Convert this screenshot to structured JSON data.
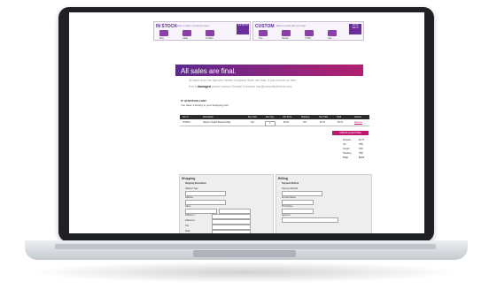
{
  "in_stock": {
    "title": "IN STOCK",
    "subtitle": "Ready to ship in 3 business days",
    "badge": "3-5 DAYS",
    "products": [
      {
        "label": "Mug"
      },
      {
        "label": "Glass"
      },
      {
        "label": "Tumbler"
      }
    ]
  },
  "custom": {
    "title": "CUSTOM",
    "subtitle": "Made to order with your logo",
    "badge": "10-15 DAYS",
    "products": [
      {
        "label": "Tote"
      },
      {
        "label": "Hoodie"
      },
      {
        "label": "T-Shirt"
      },
      {
        "label": "Cap"
      }
    ]
  },
  "sales_banner": {
    "headline": "All sales are final."
  },
  "notice": {
    "line1": "All sales from the Navarro Health Company Store are final. If you receive an item",
    "line2_prefix": "that is",
    "line2_emphasis": "damaged",
    "line2_suffix": "please contact Summit Solutions info@summitsolutions.com"
  },
  "cart": {
    "heading": "IT: QUESTION CART",
    "subheading": "You have 1 item(s) in your shopping cart",
    "columns": [
      "Item #",
      "Description",
      "Item Size",
      "Item Qty",
      "Unit Price",
      "Shipping",
      "Sub Total",
      "Total",
      "Actions"
    ],
    "rows": [
      {
        "item": "NH1001",
        "description": "Navarro Health Branded Mug",
        "size": "N/A",
        "qty": "1",
        "unit": "$4.00",
        "ship": "N/A",
        "sub": "$4.75",
        "total": "$4.75",
        "action": "Remove"
      }
    ],
    "update_button": "UPDATE QUANTITIES"
  },
  "totals": [
    {
      "label": "Subtotal",
      "value": "$4.75"
    },
    {
      "label": "Tax",
      "value": "TBD"
    },
    {
      "label": "Freight",
      "value": "TBD"
    },
    {
      "label": "Handling",
      "value": "TBD"
    },
    {
      "label": "Total",
      "value": "$4.75"
    }
  ],
  "shipping": {
    "title": "Shipping",
    "subtitle": "Shipping Destination",
    "fields": [
      "Address Type",
      "Address",
      "Name",
      "Company",
      "Address 1",
      "Address 2",
      "City",
      "State",
      "Zip"
    ]
  },
  "billing": {
    "title": "Billing",
    "subtitle": "Payment Method",
    "fields": [
      "Payment Method",
      "Account Name",
      "PO Number",
      "Approver"
    ]
  }
}
